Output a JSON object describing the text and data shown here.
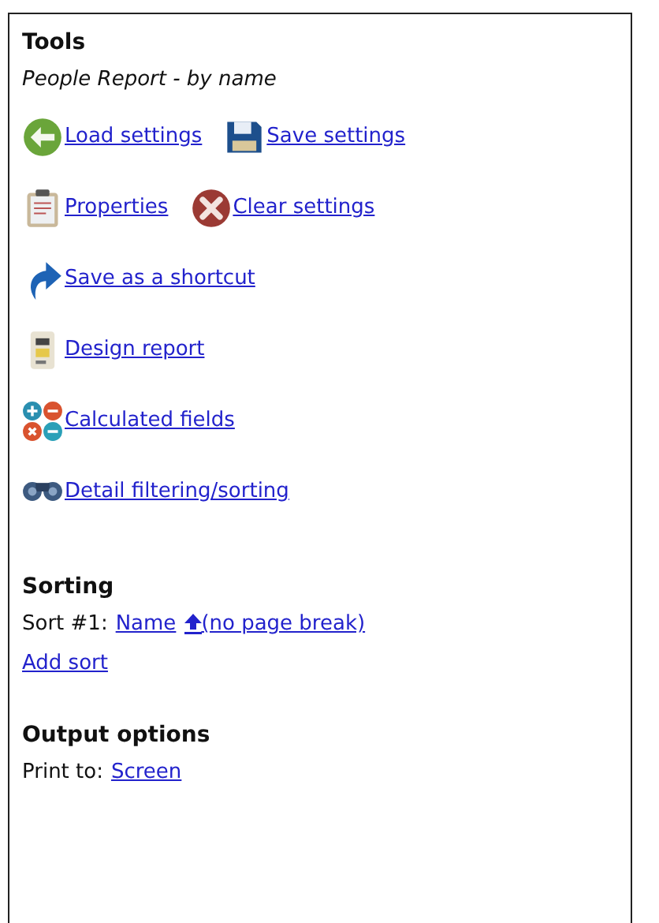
{
  "tools": {
    "title": "Tools",
    "subtitle": "People Report - by name",
    "rows": [
      [
        {
          "label": "Load settings",
          "kind": "back"
        },
        {
          "label": "Save settings",
          "kind": "floppy"
        }
      ],
      [
        {
          "label": "Properties",
          "kind": "clipboard"
        },
        {
          "label": "Clear settings",
          "kind": "clear"
        }
      ],
      [
        {
          "label": "Save as a shortcut",
          "kind": "shortcut"
        }
      ],
      [
        {
          "label": "Design report",
          "kind": "document"
        }
      ],
      [
        {
          "label": "Calculated fields",
          "kind": "math"
        }
      ],
      [
        {
          "label": "Detail filtering/sorting",
          "kind": "binoculars"
        }
      ]
    ]
  },
  "sorting": {
    "title": "Sorting",
    "sorts": [
      {
        "label": "Sort #1:",
        "field": "Name",
        "page_break": "(no page break)"
      }
    ],
    "add": "Add sort"
  },
  "output": {
    "title": "Output options",
    "label": "Print to:",
    "target": "Screen"
  }
}
